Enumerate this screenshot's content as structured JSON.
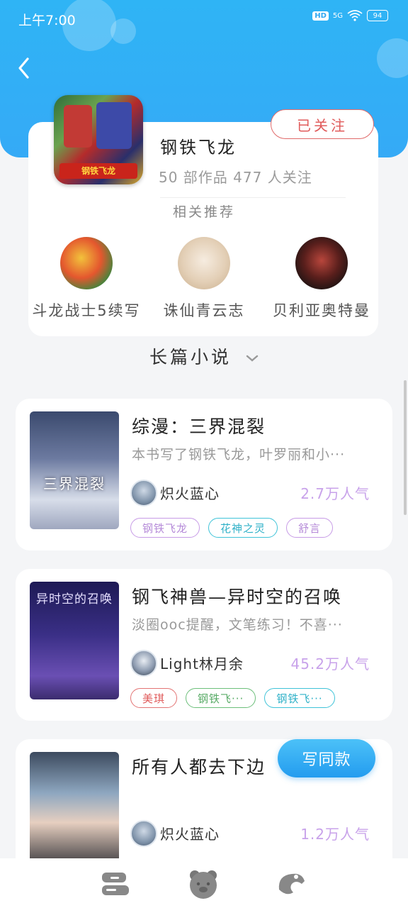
{
  "status_bar": {
    "time": "上午7:00",
    "hd": "HD",
    "signal": "5G",
    "battery": "94"
  },
  "profile": {
    "name": "钢铁飞龙",
    "stats": "50 部作品   477 人关注",
    "follow_label": "已关注",
    "avatar_caption": "钢铁飞龙"
  },
  "related": {
    "title": "相关推荐",
    "items": [
      {
        "name": "斗龙战士5续写"
      },
      {
        "name": "诛仙青云志"
      },
      {
        "name": "贝利亚奥特曼"
      }
    ]
  },
  "section": {
    "title": "长篇小说"
  },
  "books": [
    {
      "title": "综漫：三界混裂",
      "desc": "本书写了钢铁飞龙，叶罗丽和小···",
      "author": "炽火蓝心",
      "popularity": "2.7万人气",
      "cover_text": "三界混裂",
      "tags": [
        {
          "label": "钢铁飞龙",
          "color": "#c79be6"
        },
        {
          "label": "花神之灵",
          "color": "#3fc3d8"
        },
        {
          "label": "舒言",
          "color": "#c79be6"
        }
      ]
    },
    {
      "title": "钢飞神兽—异时空的召唤",
      "desc": "淡圈ooc提醒，文笔练习！不喜···",
      "author": "Light林月余",
      "popularity": "45.2万人气",
      "cover_text": "异时空的召唤",
      "tags": [
        {
          "label": "美琪",
          "color": "#e37474"
        },
        {
          "label": "钢铁飞···",
          "color": "#6cbf7a"
        },
        {
          "label": "钢铁飞···",
          "color": "#3fc3d8"
        }
      ]
    },
    {
      "title": "所有人都去下边",
      "desc": "",
      "author": "炽火蓝心",
      "popularity": "1.2万人气",
      "cover_text": "",
      "tags": []
    }
  ],
  "write_button": "写同款",
  "bottom_nav": [
    {
      "icon": "chat-bubbles-icon"
    },
    {
      "icon": "bear-face-icon"
    },
    {
      "icon": "ghost-icon"
    }
  ],
  "colors": {
    "header_blue": "#2fb4f5",
    "follow_red": "#e05a5a",
    "popularity_purple": "#c8a2ea"
  }
}
